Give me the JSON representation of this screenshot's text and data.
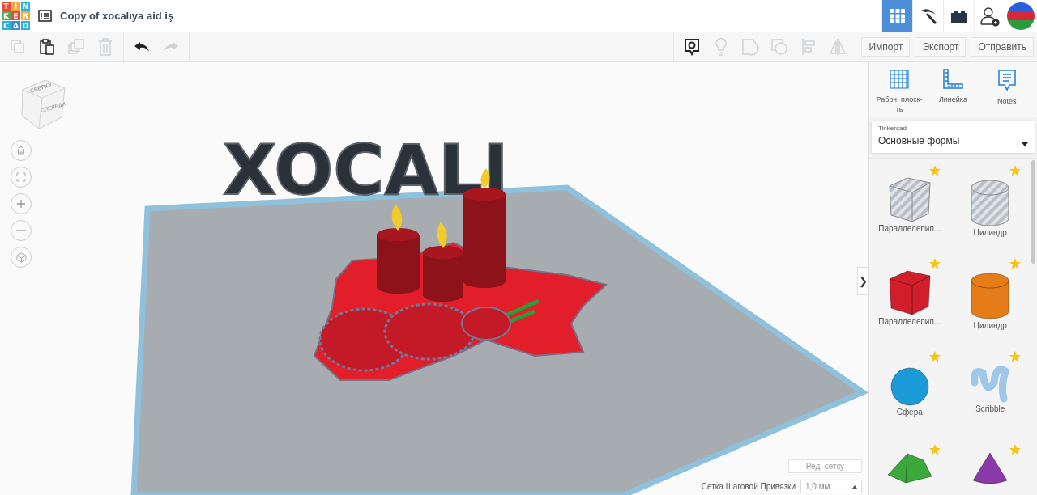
{
  "app": {
    "logo_letters": [
      "T",
      "I",
      "N",
      "K",
      "E",
      "R",
      "C",
      "A",
      "D"
    ],
    "title": "Copy of xocalıya aid iş"
  },
  "view_modes": [
    {
      "kind": "grid",
      "selected": true
    },
    {
      "kind": "pickaxe",
      "selected": false
    },
    {
      "kind": "brick",
      "selected": false
    }
  ],
  "toolbar": {
    "edit_tools": [
      {
        "kind": "copy",
        "disabled": true
      },
      {
        "kind": "paste",
        "disabled": false
      },
      {
        "kind": "duplicate",
        "disabled": true
      },
      {
        "kind": "delete",
        "disabled": true
      }
    ],
    "history": [
      {
        "kind": "undo",
        "disabled": false
      },
      {
        "kind": "redo",
        "disabled": true
      }
    ],
    "view_tools": [
      {
        "kind": "notes",
        "disabled": false
      },
      {
        "kind": "bulb",
        "disabled": true
      },
      {
        "kind": "solid",
        "disabled": true
      },
      {
        "kind": "hole",
        "disabled": true
      },
      {
        "kind": "align",
        "disabled": true
      },
      {
        "kind": "mirror",
        "disabled": true
      }
    ],
    "buttons": [
      "Импорт",
      "Экспорт",
      "Отправить"
    ]
  },
  "canvas": {
    "view_cube": {
      "top": "СВЕРХУ",
      "front": "СПЕРЕДИ"
    },
    "nav_buttons": [
      {
        "kind": "home"
      },
      {
        "kind": "fit"
      },
      {
        "kind": "zoom-in"
      },
      {
        "kind": "zoom-out"
      },
      {
        "kind": "perspective"
      }
    ],
    "model_text": "XOCALI",
    "edit_grid_button": "Ред. сетку",
    "snap_label": "Сетка Шаговой Привязки",
    "snap_value": "1,0 мм",
    "collapse_button": "❯"
  },
  "panel": {
    "tools": [
      {
        "kind": "workplane",
        "label": "Рабоч. плоск-ть"
      },
      {
        "kind": "ruler",
        "label": "Линейка"
      },
      {
        "kind": "notes",
        "label": "Notes"
      }
    ],
    "library": {
      "provider": "Tinkercad",
      "category": "Основные формы"
    },
    "shapes": [
      {
        "kind": "box",
        "hole": true,
        "color": "#c4c9d0",
        "label": "Параллелепип..."
      },
      {
        "kind": "cylinder",
        "hole": true,
        "color": "#c4c9d0",
        "label": "Цилиндр"
      },
      {
        "kind": "box",
        "hole": false,
        "color": "#d01f2a",
        "label": "Параллелепип..."
      },
      {
        "kind": "cylinder",
        "hole": false,
        "color": "#e57c17",
        "label": "Цилиндр"
      },
      {
        "kind": "sphere",
        "hole": false,
        "color": "#1a9ad6",
        "label": "Сфера"
      },
      {
        "kind": "scribble",
        "hole": false,
        "color": "#9ec8ea",
        "label": "Scribble"
      },
      {
        "kind": "roof",
        "hole": false,
        "color": "#3aa83a"
      },
      {
        "kind": "cone",
        "hole": false,
        "color": "#8a3aa8"
      }
    ]
  }
}
